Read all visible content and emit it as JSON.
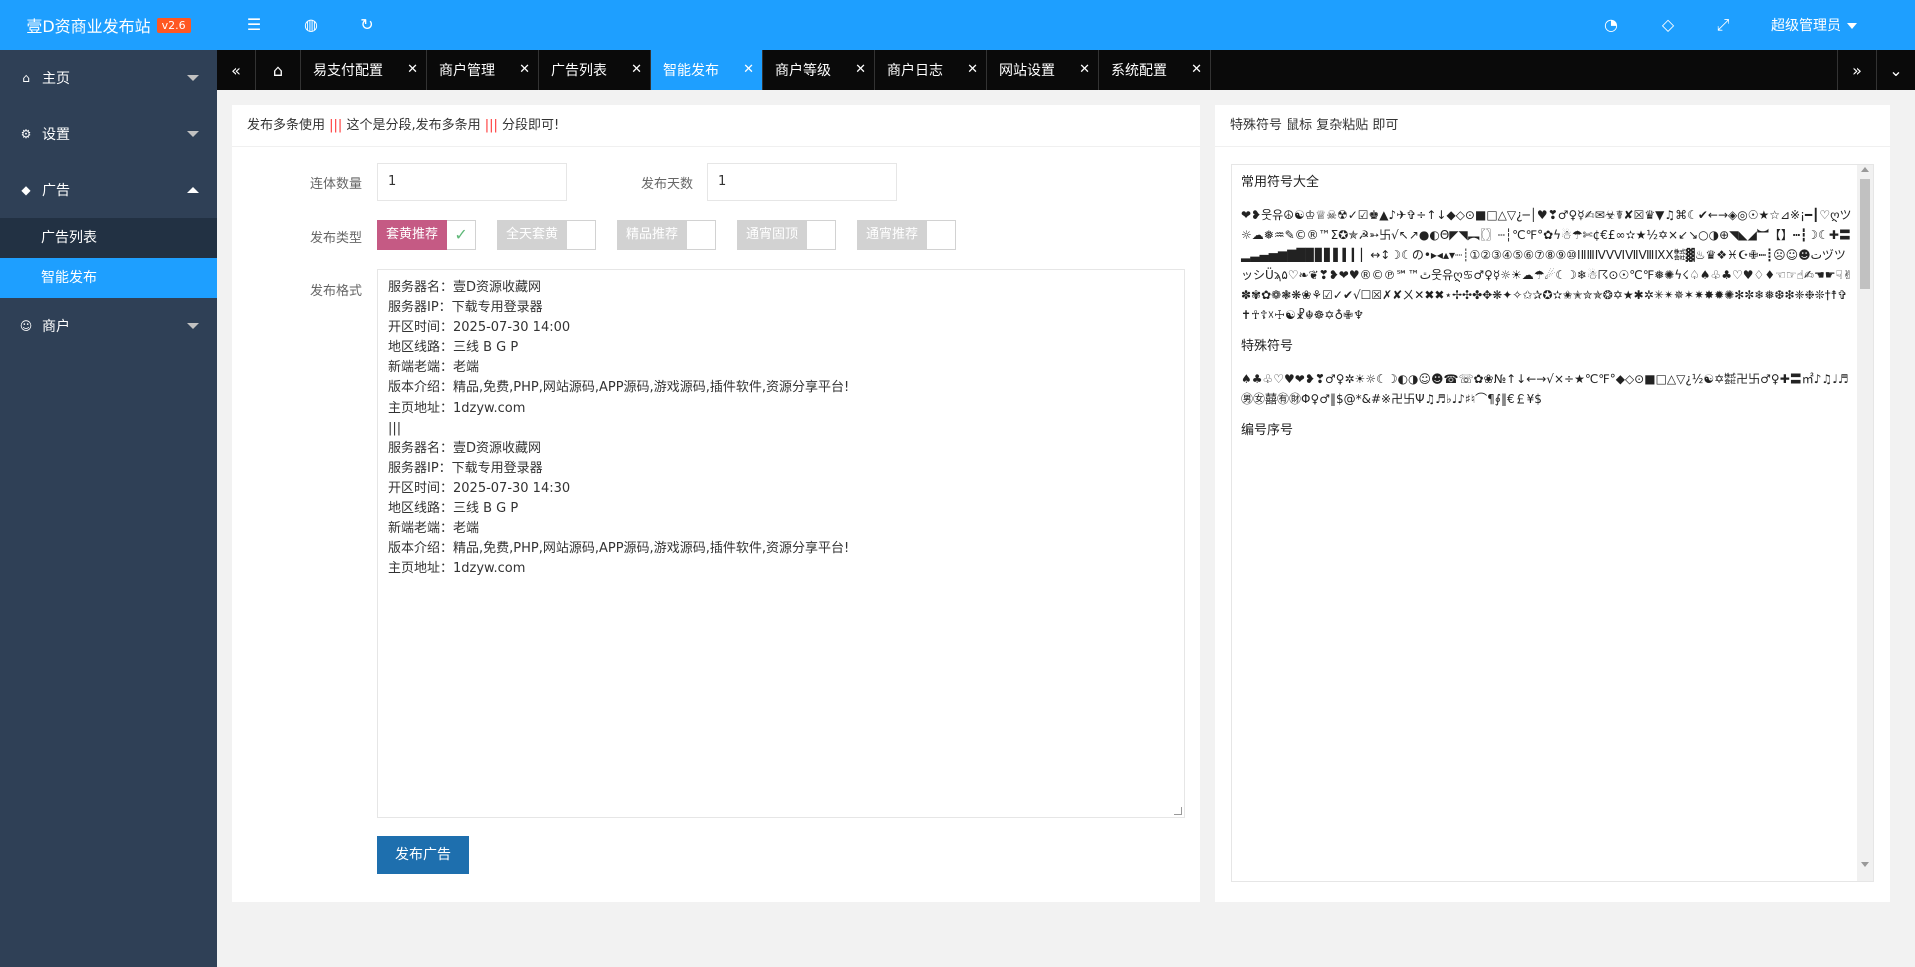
{
  "app": {
    "title": "壹D资商业发布站",
    "version": "v2.6"
  },
  "sidebar": {
    "items": [
      {
        "label": "主页",
        "icon": "home-icon"
      },
      {
        "label": "设置",
        "icon": "gear-icon"
      },
      {
        "label": "广告",
        "icon": "diamond-icon",
        "children": [
          "广告列表",
          "智能发布"
        ],
        "active_child": "智能发布"
      },
      {
        "label": "商户",
        "icon": "user-icon"
      }
    ]
  },
  "topbar": {
    "icons": [
      "menu-fold-icon",
      "globe-icon",
      "refresh-icon",
      "palette-icon",
      "tag-icon",
      "fullscreen-icon"
    ],
    "user": "超级管理员"
  },
  "tabs": [
    {
      "label": "易支付配置"
    },
    {
      "label": "商户管理"
    },
    {
      "label": "广告列表"
    },
    {
      "label": "智能发布",
      "active": true
    },
    {
      "label": "商户等级"
    },
    {
      "label": "商户日志"
    },
    {
      "label": "网站设置"
    },
    {
      "label": "系统配置"
    }
  ],
  "form": {
    "notice_pre": "发布多条使用",
    "notice_sep1": "|||",
    "notice_mid": "这个是分段,发布多条用",
    "notice_sep2": "|||",
    "notice_post": "分段即可!",
    "count_label": "连体数量",
    "count_value": "1",
    "days_label": "发布天数",
    "days_value": "1",
    "type_label": "发布类型",
    "types": [
      {
        "label": "套黄推荐",
        "on": true
      },
      {
        "label": "全天套黄",
        "on": false
      },
      {
        "label": "精品推荐",
        "on": false
      },
      {
        "label": "通宵固顶",
        "on": false
      },
      {
        "label": "通宵推荐",
        "on": false
      }
    ],
    "format_label": "发布格式",
    "format_text": "服务器名：壹D资源收藏网\n服务器IP：下载专用登录器\n开区时间：2025-07-30 14:00\n地区线路：三线 B G P\n新端老端：老端\n版本介绍：精品,免费,PHP,网站源码,APP源码,游戏源码,插件软件,资源分享平台!\n主页地址：1dzyw.com\n|||\n服务器名：壹D资源收藏网\n服务器IP：下载专用登录器\n开区时间：2025-07-30 14:30\n地区线路：三线 B G P\n新端老端：老端\n版本介绍：精品,免费,PHP,网站源码,APP源码,游戏源码,插件软件,资源分享平台!\n主页地址：1dzyw.com",
    "submit_label": "发布广告"
  },
  "symbols": {
    "title": "特殊符号 鼠标 复杂粘贴 即可",
    "sec1_title": "常用符号大全",
    "sec1_text": "❤❥웃유☮☯♔♕☠☢✓☑♚▲♪✈✞÷↑↓◆◇⊙■□△▽¿─│♥❣♂♀☿✍✉☣☤✘☒♛▼♫⌘☾✔←→◈◎☉★☆⊿※¡━┃♡ღツ☼☁❅♒✎©®™Σ✪✯☭➳卐√↖↗●◐Θ◤◥︻〖〗┄┆℃℉°✿ϟ☃☂✄¢€£∞✫★½✡×↙↘○◑⊕◥◣◢︼【】┅┇☽☾✚〓▂▃▄▅▆▇█▉▊▋▌▍▎▏↔↕☽☾の•▸◂▴▾┈┊①②③④⑤⑥⑦⑧⑨⑩ⅠⅡⅢⅣⅤⅥⅦⅧⅨⅩ㍿▓♨♛❖♓☪✙┉┋☹☺☻تヅツッシÜϡﭢ™℠℗©®♥❤❥❣❦❧♡۵웃유ღ♋♂♀☿☼☀☁☂☄☾☽❄☃☈⊙☉℃℉❅✺ϟ☇♤♠♧♣♡♥♢♦☜☞☝✍☚☛☟✌✽✾✿❁❃❋❀⚘☑✓✔√☐☒✗✘ㄨ✕✖✖⋆✢✣✤✥❋✦✧✩✰✪✫✬✭✮✯❂✡★✱✲✳✴✵✶✷✸✹✺✻✼❄❅❆❇❈❉❊†☨✞✝☥☦☓☩☯☧☬☸✡♁✙♆",
    "sec2_title": "特殊符号",
    "sec2_text": "♠♣♧♡♥❤❥❣♂♀✲☀☼☾☽◐◑☺☻☎☏✿❀№↑↓←→√×÷★℃℉°◆◇⊙■□△▽¿½☯✡㍿卍卐♂♀✚〓㎡♪♫♩♬㊚㊛囍㊒㊖Φ♀♂‖$@*&#※卍卐Ψ♫♬♭♩♪♯♮⌒¶∮‖€￡¥$",
    "sec3_title": "编号序号"
  }
}
